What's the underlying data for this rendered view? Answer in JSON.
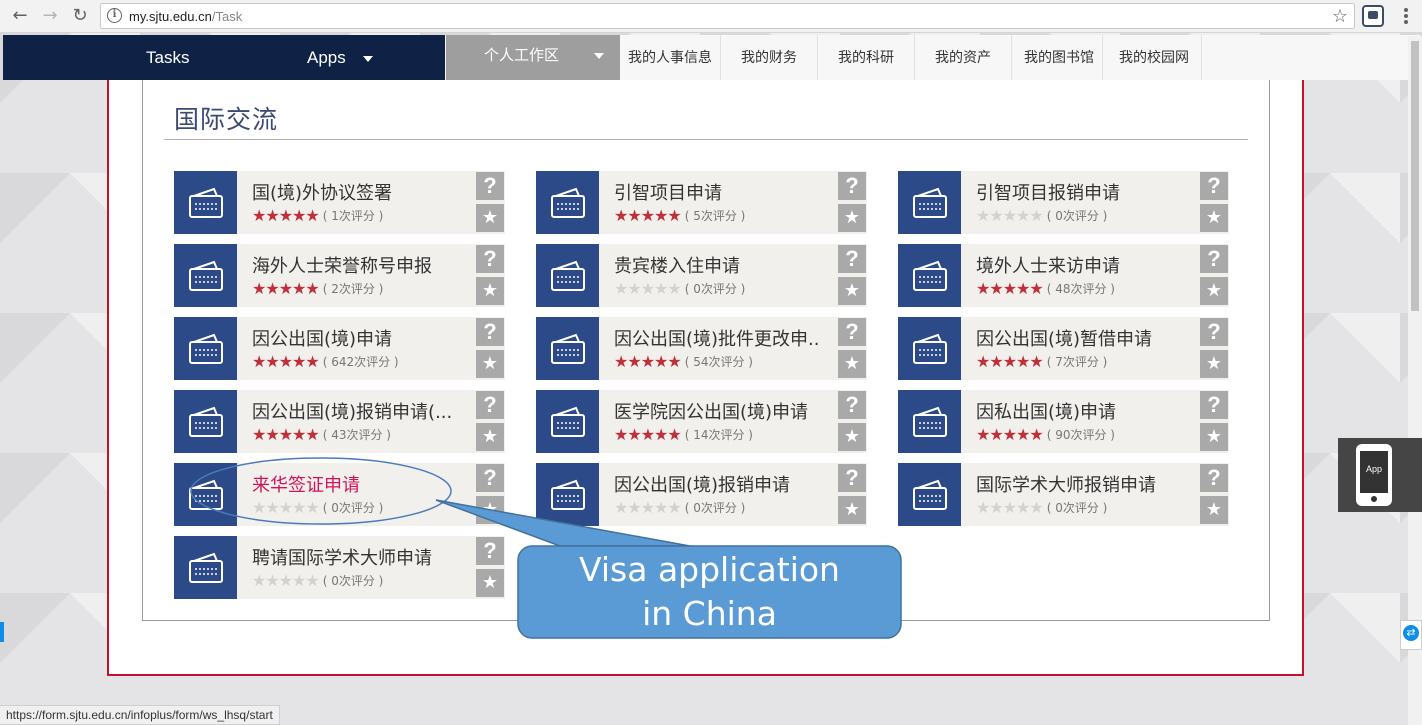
{
  "browser": {
    "url_host": "my.sjtu.edu.cn",
    "url_path": "/Task",
    "status_url": "https://form.sjtu.edu.cn/infoplus/form/ws_lhsq/start"
  },
  "topnav": {
    "tasks": "Tasks",
    "apps": "Apps",
    "workspace": "个人工作区",
    "links": [
      "我的人事信息",
      "我的财务",
      "我的科研",
      "我的资产",
      "我的图书馆",
      "我的校园网"
    ]
  },
  "section": {
    "title": "国际交流"
  },
  "cards": [
    {
      "name": "国(境)外协议签署",
      "stars": 5,
      "count": "( 1次评分 )"
    },
    {
      "name": "引智项目申请",
      "stars": 5,
      "count": "( 5次评分 )"
    },
    {
      "name": "引智项目报销申请",
      "stars": 0,
      "count": "( 0次评分 )"
    },
    {
      "name": "海外人士荣誉称号申报",
      "stars": 5,
      "count": "( 2次评分 )"
    },
    {
      "name": "贵宾楼入住申请",
      "stars": 0,
      "count": "( 0次评分 )"
    },
    {
      "name": "境外人士来访申请",
      "stars": 5,
      "count": "( 48次评分 )"
    },
    {
      "name": "因公出国(境)申请",
      "stars": 5,
      "count": "( 642次评分 )"
    },
    {
      "name": "因公出国(境)批件更改申..",
      "stars": 5,
      "count": "( 54次评分 )"
    },
    {
      "name": "因公出国(境)暂借申请",
      "stars": 5,
      "count": "( 7次评分 )"
    },
    {
      "name": "因公出国(境)报销申请(...",
      "stars": 5,
      "count": "( 43次评分 )"
    },
    {
      "name": "医学院因公出国(境)申请",
      "stars": 5,
      "count": "( 14次评分 )"
    },
    {
      "name": "因私出国(境)申请",
      "stars": 5,
      "count": "( 90次评分 )"
    },
    {
      "name": "来华签证申请",
      "stars": 0,
      "count": "( 0次评分 )",
      "highlight": true
    },
    {
      "name": "因公出国(境)报销申请",
      "stars": 0,
      "count": "( 0次评分 )"
    },
    {
      "name": "国际学术大师报销申请",
      "stars": 0,
      "count": "( 0次评分 )"
    },
    {
      "name": "聘请国际学术大师申请",
      "stars": 0,
      "count": "( 0次评分 )"
    }
  ],
  "glyphs": {
    "help": "?",
    "fav": "★",
    "star": "★"
  },
  "callout": {
    "line1": "Visa application",
    "line2": "in China"
  },
  "app_widget": {
    "label": "App"
  },
  "colors": {
    "nav_dark": "#0f2245",
    "tile": "#2b4a87",
    "accent_red": "#c8102e",
    "highlight": "#d1135b",
    "callout": "#5b9bd5"
  }
}
